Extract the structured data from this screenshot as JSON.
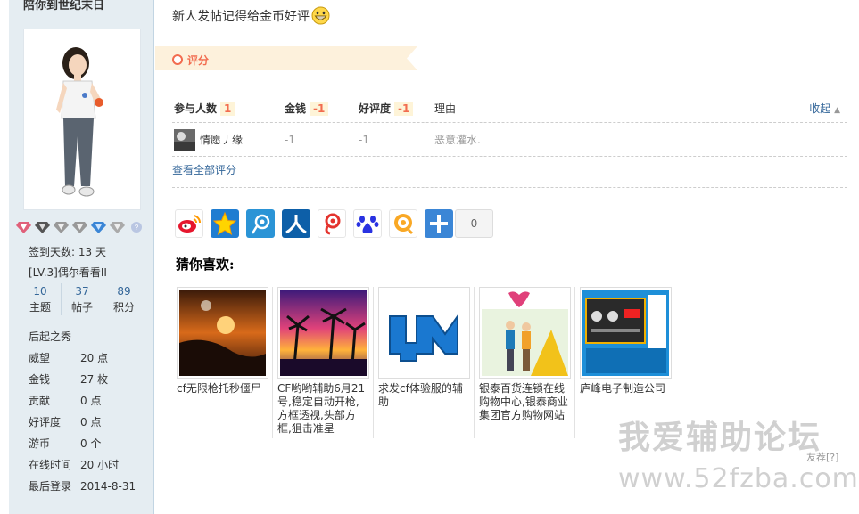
{
  "sidebar": {
    "username": "陪你到世纪末日",
    "signin_days": "签到天数: 13 天",
    "level": "[LV.3]偶尔看看II",
    "stats": [
      {
        "num": "10",
        "label": "主题"
      },
      {
        "num": "37",
        "label": "帖子"
      },
      {
        "num": "89",
        "label": "积分"
      }
    ],
    "rank": "后起之秀",
    "profile": [
      {
        "key": "威望",
        "value": "20 点"
      },
      {
        "key": "金钱",
        "value": "27 枚"
      },
      {
        "key": "贡献",
        "value": "0 点"
      },
      {
        "key": "好评度",
        "value": "0 点"
      },
      {
        "key": "游币",
        "value": "0 个"
      },
      {
        "key": "在线时间",
        "value": "20 小时"
      },
      {
        "key": "最后登录",
        "value": "2014-8-31"
      }
    ]
  },
  "post": {
    "text": "新人发帖记得给金币好评"
  },
  "rating": {
    "banner_label": "评分",
    "head": {
      "participants": "参与人数",
      "participants_count": "1",
      "money": "金钱",
      "money_value": "-1",
      "reputation": "好评度",
      "reputation_value": "-1",
      "reason": "理由",
      "collapse": "收起"
    },
    "rows": [
      {
        "user": "情愿丿缘",
        "money": "-1",
        "reputation": "-1",
        "reason": "恶意灌水."
      }
    ],
    "view_all": "查看全部评分"
  },
  "share": {
    "icons": [
      "weibo-icon",
      "qzone-icon",
      "tencent-weibo-icon",
      "renren-icon",
      "kaixin-icon",
      "baidu-icon",
      "douban-icon",
      "more-share-icon"
    ],
    "count": "0"
  },
  "recommend": {
    "title": "猜你喜欢:",
    "items": [
      {
        "caption": "cf无限枪托秒僵尸"
      },
      {
        "caption": "CF哟哟辅助6月21号,稳定自动开枪,方框透视,头部方框,狙击准星"
      },
      {
        "caption": "求发cf体验服的辅助"
      },
      {
        "caption": "银泰百货连锁在线购物中心,银泰商业集团官方购物网站"
      },
      {
        "caption": "庐峰电子制造公司"
      }
    ],
    "friend_rec": "友荐[?]"
  },
  "watermark": {
    "line1": "我爱辅助论坛",
    "line2": "www.52fzba.com"
  }
}
